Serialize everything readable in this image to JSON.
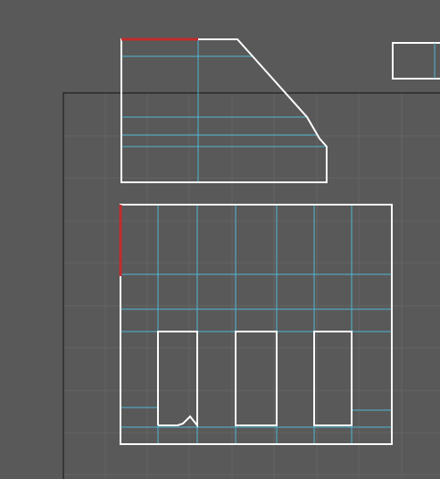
{
  "viewport": {
    "background_color": "#595959",
    "grid_color": "#646464",
    "page_border_color": "#141414",
    "outline_color": "#ffffff",
    "guide_color": "#4fb8d6",
    "selected_edge_color": "#c42a2a"
  }
}
